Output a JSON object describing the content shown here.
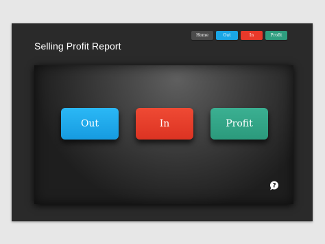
{
  "slide": {
    "title": "Selling Profit Report"
  },
  "nav": {
    "home": "Home",
    "out": "Out",
    "in": "In",
    "profit": "Profit"
  },
  "buttons": {
    "out": "Out",
    "in": "In",
    "profit": "Profit"
  },
  "colors": {
    "out": "#1aa6e6",
    "in": "#e9392a",
    "profit": "#2f9e7f",
    "home": "#4b4b4b"
  },
  "icons": {
    "help": "help-bubble-icon"
  }
}
